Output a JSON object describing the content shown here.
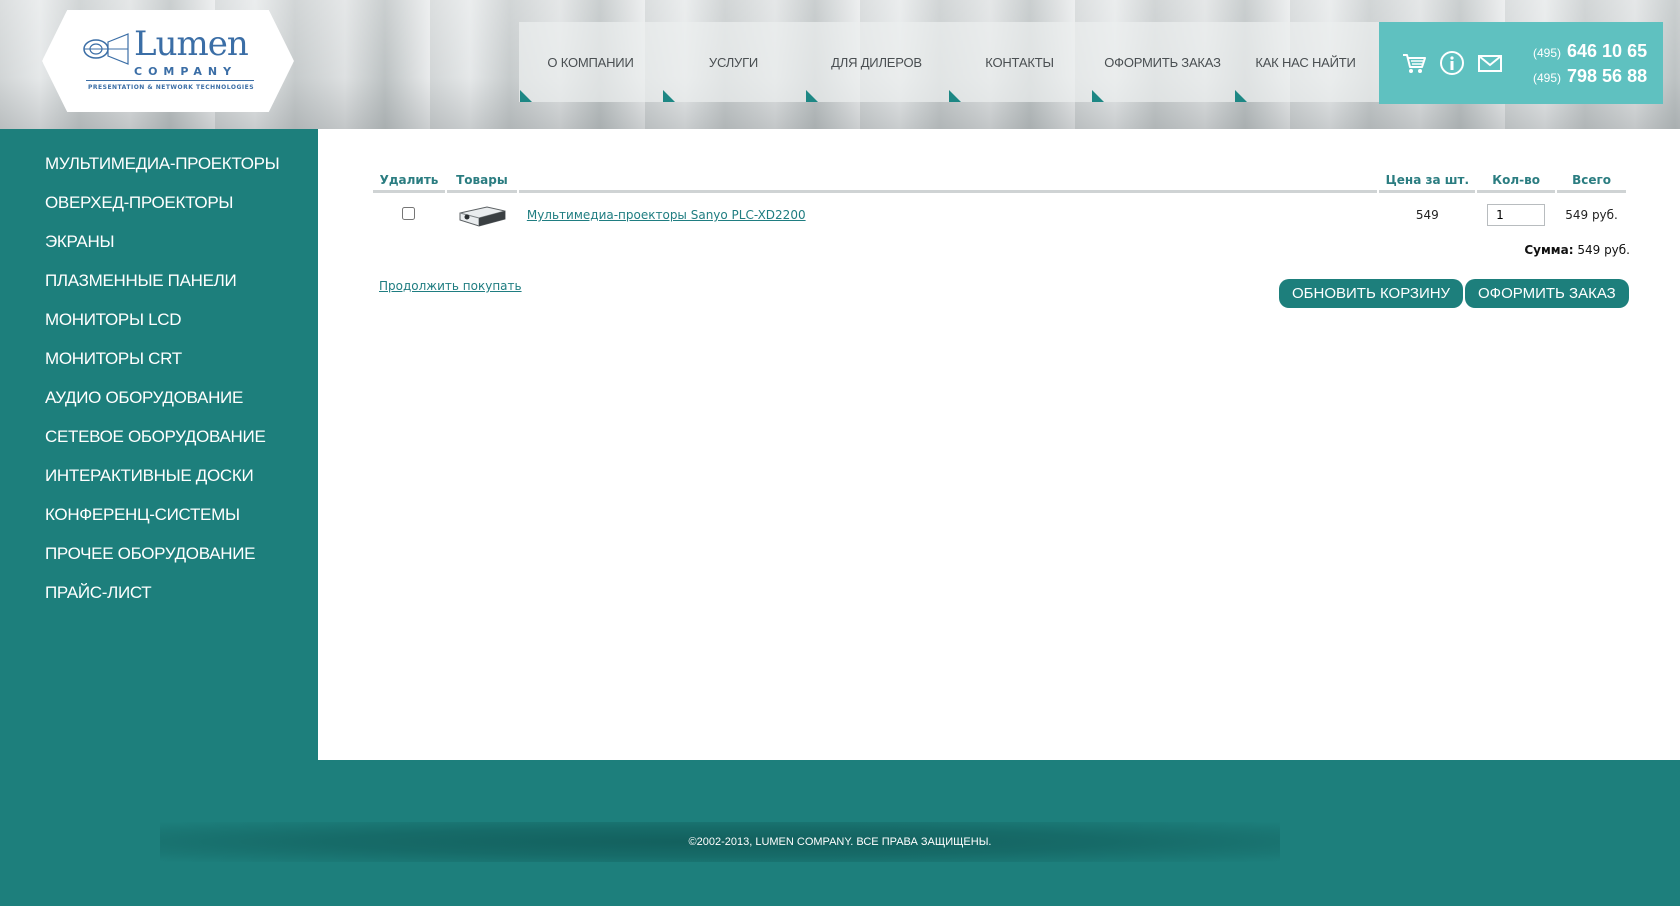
{
  "brand": {
    "name": "Lumen",
    "company": "COMPANY",
    "tagline": "PRESENTATION & NETWORK TECHNOLOGIES"
  },
  "nav": [
    {
      "label": "О КОМПАНИИ"
    },
    {
      "label": "УСЛУГИ"
    },
    {
      "label": "ДЛЯ ДИЛЕРОВ"
    },
    {
      "label": "КОНТАКТЫ"
    },
    {
      "label": "ОФОРМИТЬ ЗАКАЗ"
    },
    {
      "label": "КАК НАС НАЙТИ"
    }
  ],
  "contacts": {
    "icons": [
      "cart-icon",
      "info-icon",
      "mail-icon"
    ],
    "phones": [
      {
        "code": "(495)",
        "number": "646 10 65"
      },
      {
        "code": "(495)",
        "number": "798 56 88"
      }
    ]
  },
  "sidebar": {
    "items": [
      {
        "label": "МУЛЬТИМЕДИА-ПРОЕКТОРЫ"
      },
      {
        "label": "ОВЕРХЕД-ПРОЕКТОРЫ"
      },
      {
        "label": "ЭКРАНЫ"
      },
      {
        "label": "ПЛАЗМЕННЫЕ ПАНЕЛИ"
      },
      {
        "label": "МОНИТОРЫ LCD"
      },
      {
        "label": "МОНИТОРЫ CRT"
      },
      {
        "label": "АУДИО ОБОРУДОВАНИЕ"
      },
      {
        "label": "СЕТЕВОЕ ОБОРУДОВАНИЕ"
      },
      {
        "label": "ИНТЕРАКТИВНЫЕ ДОСКИ"
      },
      {
        "label": "КОНФЕРЕНЦ-СИСТЕМЫ"
      },
      {
        "label": "ПРОЧЕЕ ОБОРУДОВАНИЕ"
      },
      {
        "label": "ПРАЙС-ЛИСТ"
      }
    ]
  },
  "cart": {
    "headers": {
      "delete": "Удалить",
      "goods": "Товары",
      "name": "",
      "price": "Цена за шт.",
      "qty": "Кол-во",
      "total": "Всего"
    },
    "rows": [
      {
        "checked": false,
        "name": "Мультимедиа-проекторы Sanyo PLC-XD2200",
        "price": "549",
        "qty": "1",
        "total": "549 руб."
      }
    ],
    "sum_label": "Сумма:",
    "sum_value": "549 руб.",
    "continue_label": "Продолжить покупать",
    "update_label": "ОБНОВИТЬ КОРЗИНУ",
    "checkout_label": "ОФОРМИТЬ ЗАКАЗ"
  },
  "footer": {
    "copyright": "©2002-2013, LUMEN COMPANY. ВСЕ ПРАВА ЗАЩИЩЕНЫ."
  },
  "colors": {
    "teal": "#1d7f7c",
    "light_teal": "#5fc1c0",
    "link": "#1f7d81"
  }
}
